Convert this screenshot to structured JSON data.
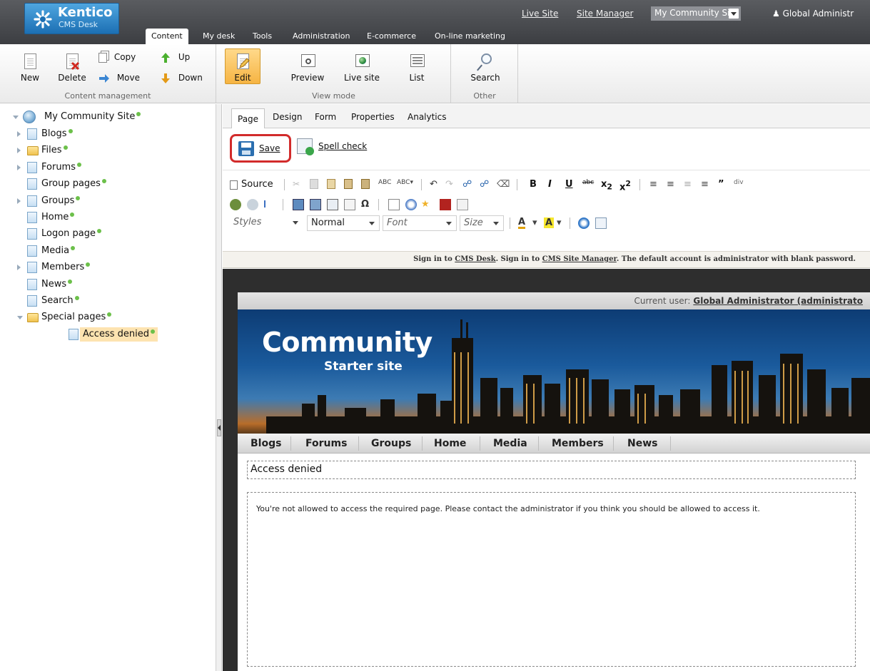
{
  "header": {
    "logo_name": "Kentico",
    "logo_sub": "CMS Desk",
    "links": [
      "Live Site",
      "Site Manager"
    ],
    "site_select": "My Community Site",
    "user": "Global Administr",
    "tabs": [
      "Content",
      "My desk",
      "Tools",
      "Administration",
      "E-commerce",
      "On-line marketing"
    ]
  },
  "ribbon": {
    "content_management": {
      "label": "Content management",
      "new": "New",
      "delete": "Delete",
      "copy": "Copy",
      "move": "Move",
      "up": "Up",
      "down": "Down"
    },
    "view_mode": {
      "label": "View mode",
      "edit": "Edit",
      "preview": "Preview",
      "live_site": "Live site",
      "list": "List"
    },
    "other": {
      "label": "Other",
      "search": "Search"
    }
  },
  "tree": {
    "root": "My Community Site",
    "items": [
      {
        "label": "Blogs",
        "icon": "page-icon",
        "expandable": true
      },
      {
        "label": "Files",
        "icon": "folder-icon",
        "expandable": true
      },
      {
        "label": "Forums",
        "icon": "page-icon",
        "expandable": true
      },
      {
        "label": "Group pages",
        "icon": "page-icon",
        "expandable": false
      },
      {
        "label": "Groups",
        "icon": "page-icon",
        "expandable": true
      },
      {
        "label": "Home",
        "icon": "page-icon",
        "expandable": false
      },
      {
        "label": "Logon page",
        "icon": "page-icon",
        "expandable": false
      },
      {
        "label": "Media",
        "icon": "page-icon",
        "expandable": false
      },
      {
        "label": "Members",
        "icon": "page-icon",
        "expandable": true
      },
      {
        "label": "News",
        "icon": "page-icon",
        "expandable": false
      },
      {
        "label": "Search",
        "icon": "page-icon",
        "expandable": false
      },
      {
        "label": "Special pages",
        "icon": "folder-icon",
        "expandable": true,
        "expanded": true
      },
      {
        "label": "Access denied",
        "icon": "page-icon",
        "selected": true
      }
    ]
  },
  "content": {
    "subtabs": [
      "Page",
      "Design",
      "Form",
      "Properties",
      "Analytics"
    ],
    "save": "Save",
    "spell_check": "Spell check",
    "toolbar": {
      "source": "Source",
      "styles": "Styles",
      "format": "Normal",
      "font": "Font",
      "size": "Size"
    },
    "info": {
      "prefix": "Sign in to ",
      "cms_desk": "CMS Desk",
      "middle": ". Sign in to ",
      "site_manager": "CMS Site Manager",
      "suffix": ". The default account is administrator with blank password."
    }
  },
  "site": {
    "current_user_label": "Current user:",
    "current_user": "Global Administrator (administrato",
    "banner_title": "Community",
    "banner_sub": "Starter site",
    "nav": [
      "Blogs",
      "Forums",
      "Groups",
      "Home",
      "Media",
      "Members",
      "News"
    ],
    "page_title": "Access denied",
    "page_body": "You're not allowed to access the required page. Please contact the administrator if you think you should be allowed to access it."
  },
  "colors": {
    "header_bg": "#4a4c50",
    "logo_blue": "#2a86cc",
    "selected_orange": "#f6b443",
    "save_highlight": "#d22b2b",
    "status_green": "#6cc04a"
  }
}
